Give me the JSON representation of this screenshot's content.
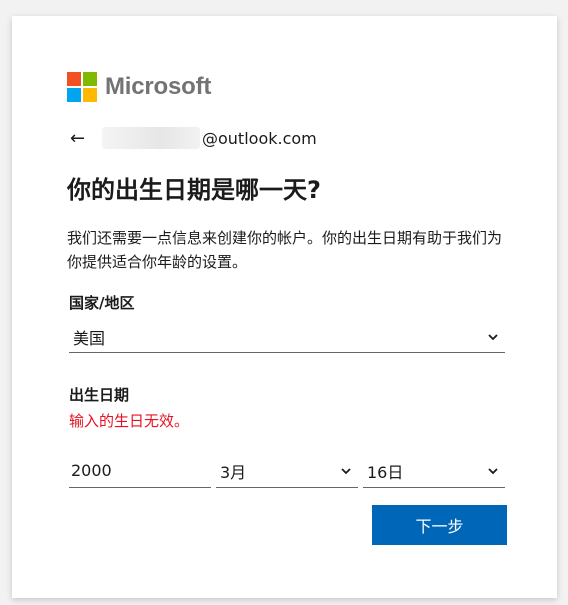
{
  "brand": {
    "name": "Microsoft",
    "colors": {
      "red": "#f25022",
      "green": "#7fba00",
      "blue": "#00a4ef",
      "yellow": "#ffb900"
    }
  },
  "identity": {
    "back_icon": "arrow-left-icon",
    "email_domain": "@outlook.com"
  },
  "page": {
    "title": "你的出生日期是哪一天?",
    "description": "我们还需要一点信息来创建你的帐户。你的出生日期有助于我们为你提供适合你年龄的设置。"
  },
  "country": {
    "label": "国家/地区",
    "value": "美国"
  },
  "birthdate": {
    "label": "出生日期",
    "error": "输入的生日无效。",
    "year": "2000",
    "month": "3月",
    "day": "16日"
  },
  "actions": {
    "next_label": "下一步",
    "accent": "#0067b8"
  }
}
